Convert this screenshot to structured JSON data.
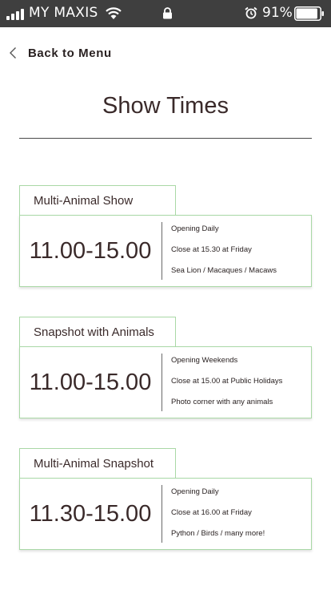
{
  "status_bar": {
    "carrier": "MY MAXIS",
    "battery_percent": "91%",
    "battery_level": 0.91
  },
  "nav": {
    "back_label": "Back to Menu"
  },
  "page": {
    "title": "Show Times"
  },
  "shows": [
    {
      "name": "Multi-Animal Show",
      "time": "11.00-15.00",
      "details": [
        "Opening Daily",
        "Close at 15.30 at Friday",
        "Sea Lion / Macaques / Macaws"
      ]
    },
    {
      "name": "Snapshot with Animals",
      "time": "11.00-15.00",
      "details": [
        "Opening Weekends",
        "Close at 15.00 at Public Holidays",
        "Photo corner with any animals"
      ]
    },
    {
      "name": "Multi-Animal Snapshot",
      "time": "11.30-15.00",
      "details": [
        "Opening Daily",
        "Close at 16.00 at Friday",
        "Python / Birds / many more!"
      ]
    }
  ],
  "colors": {
    "status_bar_bg": "#3f3f3f",
    "card_border": "#a9d8a6",
    "text": "#3a2a2a"
  }
}
